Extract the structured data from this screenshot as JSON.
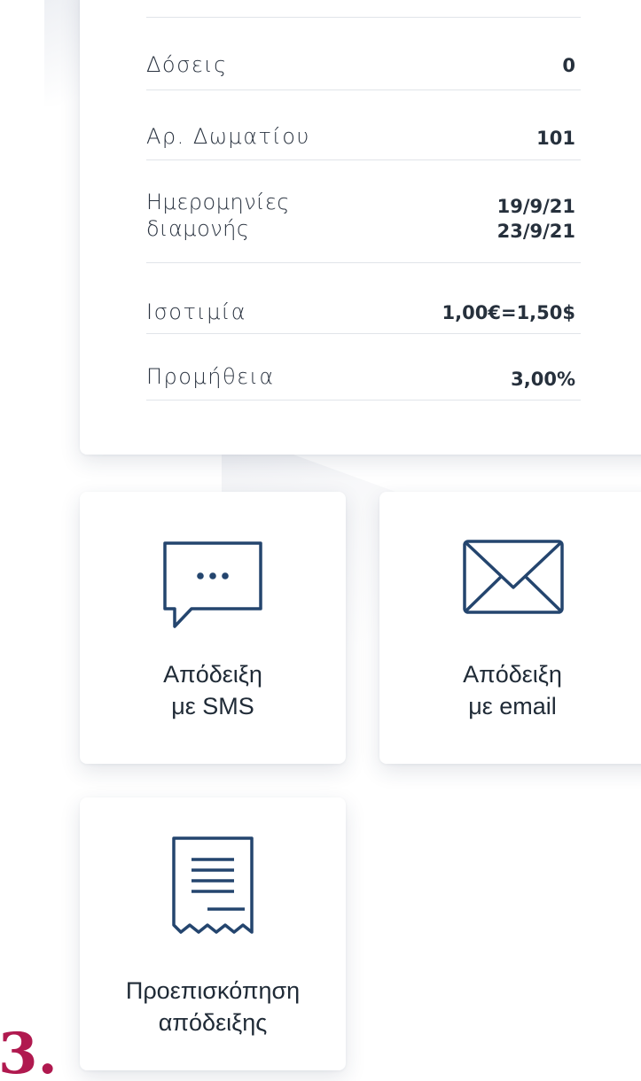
{
  "details": {
    "rows": [
      {
        "label": "Δόσεις",
        "value": "0"
      },
      {
        "label": "Αρ. Δωματίου",
        "value": "101"
      },
      {
        "label": "Ημερομηνίες\nδιαμονής",
        "value": "19/9/21\n23/9/21"
      },
      {
        "label": "Ισοτιμία",
        "value": "1,00€=1,50$"
      },
      {
        "label": "Προμήθεια",
        "value": "3,00%"
      }
    ]
  },
  "actions": {
    "sms": {
      "line1": "Απόδειξη",
      "line2": "με SMS",
      "icon": "chat-bubble-icon"
    },
    "email": {
      "line1": "Απόδειξη",
      "line2": "με email",
      "icon": "envelope-icon"
    },
    "preview": {
      "line1": "Προεπισκόπηση",
      "line2": "απόδειξης",
      "icon": "receipt-icon"
    }
  },
  "step_label": "3.",
  "colors": {
    "icon_stroke": "#24456e",
    "accent": "#b0194f",
    "divider": "#e1e4e9"
  }
}
